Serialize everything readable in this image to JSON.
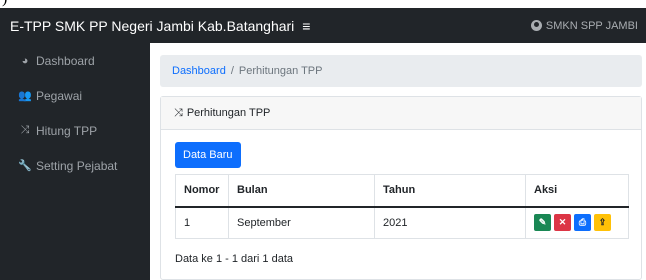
{
  "topbar": {
    "brand": "E-TPP SMK PP Negeri Jambi Kab.Batanghari",
    "toggle_icon": "≡",
    "user_label": "SMKN SPP JAMBI"
  },
  "sidebar": {
    "items": [
      {
        "label": "Dashboard",
        "icon": "palette-icon",
        "glyph": "◕"
      },
      {
        "label": "Pegawai",
        "icon": "users-icon",
        "glyph": "👥"
      },
      {
        "label": "Hitung TPP",
        "icon": "shuffle-icon",
        "glyph": "⤨"
      },
      {
        "label": "Setting Pejabat",
        "icon": "wrench-icon",
        "glyph": "🔧"
      }
    ]
  },
  "breadcrumb": {
    "link": "Dashboard",
    "separator": "/",
    "current": "Perhitungan TPP"
  },
  "card": {
    "title": "Perhitungan TPP",
    "title_icon": "⤨",
    "new_button": "Data Baru",
    "table": {
      "headers": [
        "Nomor",
        "Bulan",
        "Tahun",
        "Aksi"
      ],
      "rows": [
        {
          "nomor": "1",
          "bulan": "September",
          "tahun": "2021"
        }
      ]
    },
    "actions": [
      {
        "name": "edit",
        "glyph": "✎"
      },
      {
        "name": "delete",
        "glyph": "✕"
      },
      {
        "name": "print",
        "glyph": "⎙"
      },
      {
        "name": "upload",
        "glyph": "⇪"
      }
    ],
    "footer": "Data ke 1 - 1 dari 1 data"
  },
  "colors": {
    "sidebar_bg": "#212529",
    "primary": "#0d6efd",
    "success": "#198754",
    "danger": "#dc3545",
    "warning": "#ffc107"
  },
  "partial_text_above": ")"
}
